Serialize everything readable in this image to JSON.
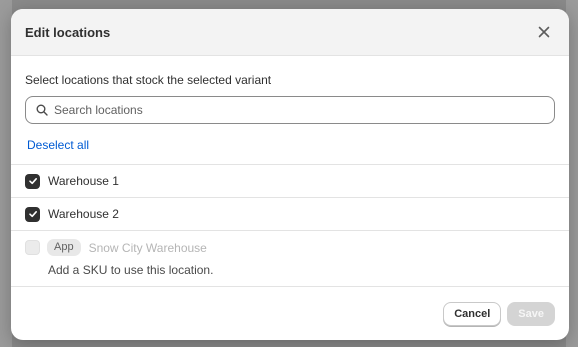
{
  "modal": {
    "title": "Edit locations",
    "close_icon": "close-icon"
  },
  "instruction": "Select locations that stock the selected variant",
  "search": {
    "placeholder": "Search locations",
    "value": "",
    "icon": "search-icon"
  },
  "deselect_label": "Deselect all",
  "locations": [
    {
      "label": "Warehouse 1",
      "checked": true
    },
    {
      "label": "Warehouse 2",
      "checked": true
    }
  ],
  "app_location": {
    "badge": "App",
    "name": "Snow City Warehouse",
    "note": "Add a SKU to use this location.",
    "checked": false,
    "disabled": true
  },
  "footer": {
    "cancel_label": "Cancel",
    "save_label": "Save"
  },
  "colors": {
    "link": "#005bd3",
    "checkbox_checked": "#303030",
    "save_disabled": "#d4d4d4"
  }
}
